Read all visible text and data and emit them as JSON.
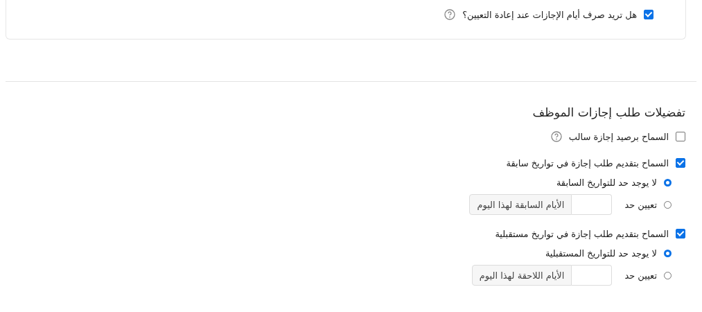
{
  "reassign": {
    "label": "هل تريد صرف أيام الإجازات عند إعادة التعيين؟",
    "checked": true,
    "help": true
  },
  "preferences": {
    "title": "تفضيلات طلب إجازات الموظف",
    "items": [
      {
        "label": "السماح برصيد إجازة سالب",
        "checked": false,
        "help": true
      },
      {
        "label": "السماح بتقديم طلب إجازة في تواريخ سابقة",
        "checked": true,
        "help": false,
        "options": [
          {
            "kind": "radio",
            "label": "لا يوجد حد للتواريخ السابقة",
            "selected": true
          },
          {
            "kind": "limit",
            "label": "تعيين حد",
            "selected": false,
            "suffix": "الأيام السابقة لهذا اليوم"
          }
        ]
      },
      {
        "label": "السماح بتقديم طلب إجازة في تواريخ مستقبلية",
        "checked": true,
        "help": false,
        "options": [
          {
            "kind": "radio",
            "label": "لا يوجد حد للتواريخ المستقبلية",
            "selected": true
          },
          {
            "kind": "limit",
            "label": "تعيين حد",
            "selected": false,
            "suffix": "الأيام اللاحقة لهذا اليوم"
          }
        ]
      }
    ]
  }
}
